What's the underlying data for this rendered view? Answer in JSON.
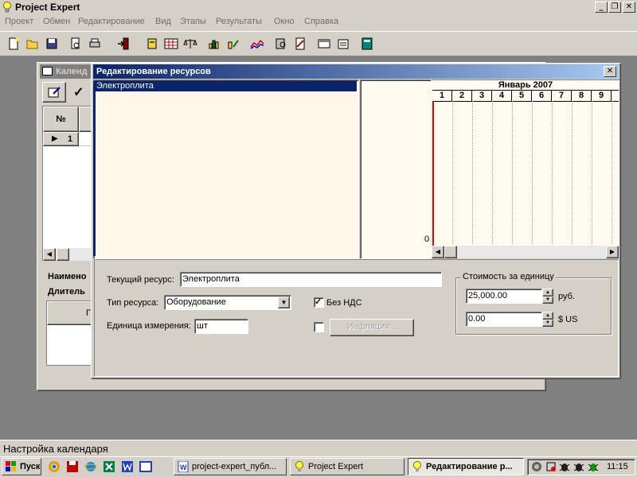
{
  "app": {
    "title": "Project Expert"
  },
  "menu": [
    {
      "label": "Проект"
    },
    {
      "label": "Обмен"
    },
    {
      "label": "Редактирование"
    },
    {
      "label": "Вид"
    },
    {
      "label": "Этапы"
    },
    {
      "label": "Результаты"
    },
    {
      "label": "Окно"
    },
    {
      "label": "Справка"
    }
  ],
  "calendar_window": {
    "title": "Календ",
    "grid_header_no": "№",
    "row_marker": "▶",
    "row_number": "1",
    "label_name": "Наимено",
    "label_duration": "Длитель",
    "panel_header": "П"
  },
  "dialog": {
    "title": "Редактирование ресурсов",
    "resources": [
      "Электроплита"
    ],
    "gantt_month": "Январь 2007",
    "gantt_days": [
      "1",
      "2",
      "3",
      "4",
      "5",
      "6",
      "7",
      "8",
      "9",
      "1"
    ],
    "gantt_zero": "0",
    "current_resource_label": "Текущий ресурс:",
    "current_resource_value": "Электроплита",
    "resource_type_label": "Тип ресурса:",
    "resource_type_value": "Оборудование",
    "unit_label": "Единица измерения:",
    "unit_value": "шт",
    "no_vat_label": "Без НДС",
    "no_vat_checked": true,
    "inflation_label": "Инфляция...",
    "inflation_checked": false,
    "cost_group_label": "Стоимость за единицу",
    "cost_rub_value": "25,000.00",
    "cost_rub_unit": "руб.",
    "cost_usd_value": "0.00",
    "cost_usd_unit": "$ US"
  },
  "status_bar": {
    "text": "Настройка календаря"
  },
  "taskbar": {
    "start_label": "Пуск",
    "buttons": [
      {
        "label": "project-expert_публ..."
      },
      {
        "label": "Project Expert"
      },
      {
        "label": "Редактирование р..."
      }
    ],
    "clock": "11:15"
  },
  "colors": {
    "title_active": "#0a246a",
    "title_active_end": "#a6caf0",
    "title_inactive": "#808080",
    "face": "#d4d0c8",
    "gantt_bg": "#fffbf0",
    "list_bg": "#fff8e8"
  }
}
